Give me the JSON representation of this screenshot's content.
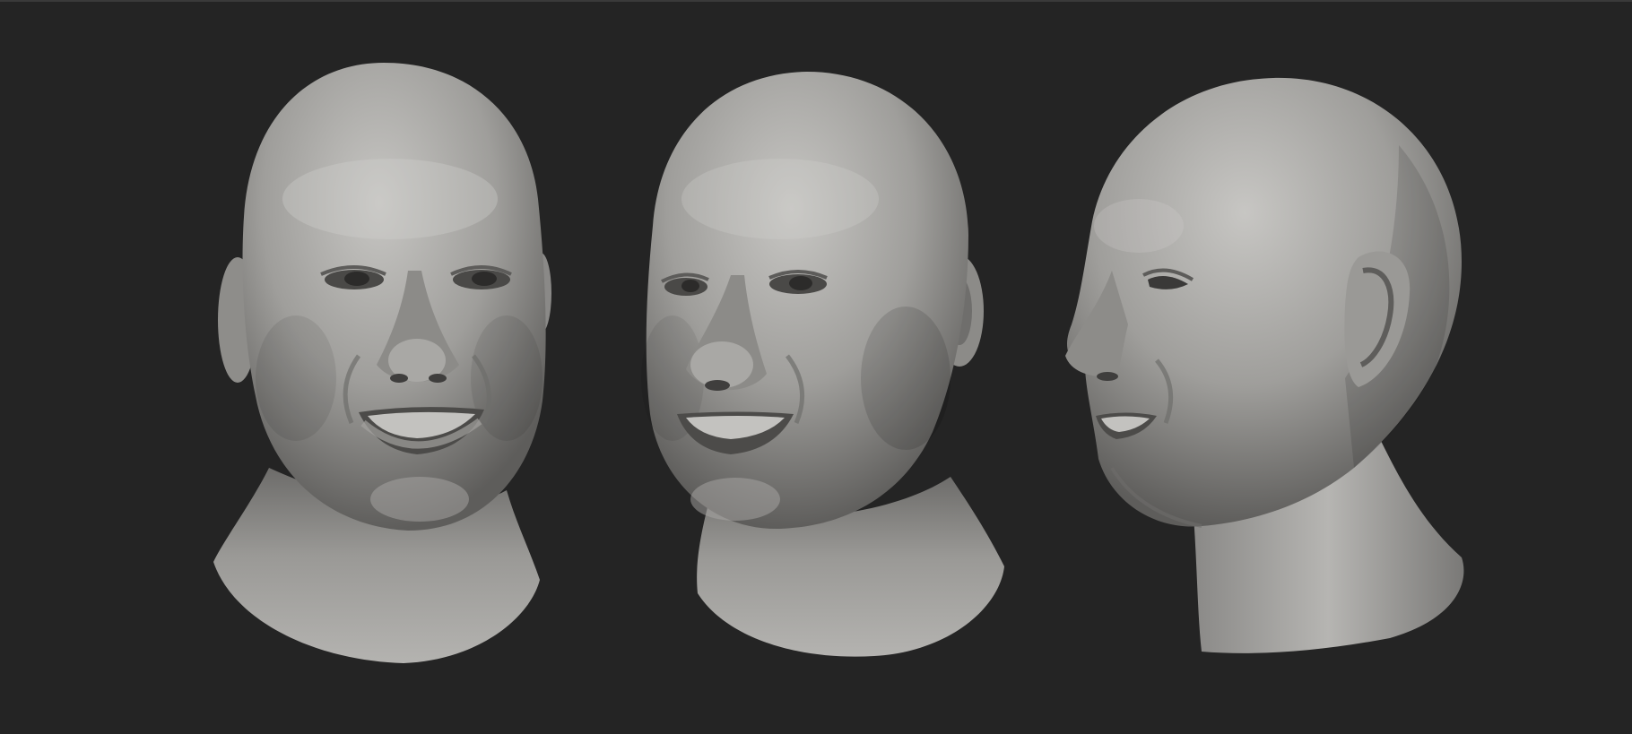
{
  "scene": {
    "background_color": "#242424",
    "material_color": "#a7a6a4",
    "views": [
      {
        "name": "front-view",
        "description_hidden": true
      },
      {
        "name": "three-quarter-view",
        "description_hidden": true
      },
      {
        "name": "profile-view",
        "description_hidden": true
      }
    ]
  }
}
